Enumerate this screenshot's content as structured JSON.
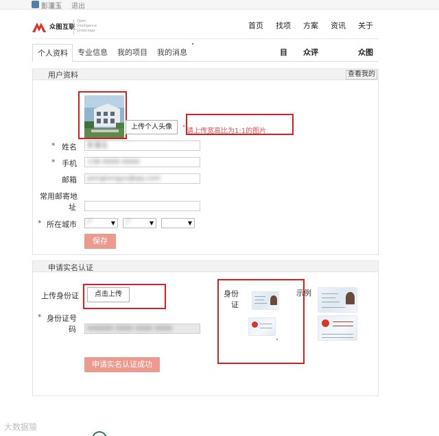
{
  "user_bar": {
    "username": "彭潼玉",
    "logout": "退出"
  },
  "header": {
    "logo_text": "众图互联",
    "logo_sub": "Open Intelligence Linkbridge",
    "nav": [
      "首页",
      "找项",
      "方案",
      "资讯",
      "关于"
    ]
  },
  "tabs": {
    "items": [
      "个人资料",
      "专业信息",
      "我的项目",
      "我的消息"
    ],
    "right": [
      "目",
      "众评",
      "众图"
    ]
  },
  "profile": {
    "section_title": "用户资料",
    "view_mine": "查看我的",
    "upload_avatar": "上传个人头像",
    "upload_hint": "请上传宽高比为1:1的图片",
    "required_mark": "*",
    "fields": {
      "name_label": "姓名",
      "name_value": "彭潼玉",
      "phone_label": "手机",
      "phone_value": "138 0000 0000",
      "email_label": "邮箱",
      "email_value": "pengtongyu@qq.com",
      "address_label_1": "常用邮寄地",
      "address_label_2": "址",
      "address_value": "",
      "city_label": "所在城市",
      "city_options": [
        "广",
        "广",
        ""
      ]
    },
    "save": "保存"
  },
  "verify": {
    "section_title": "申请实名认证",
    "id_upload_label": "上传身份证",
    "id_upload_button": "点击上传",
    "id_number_label_1": "身份证号",
    "id_number_label_2": "码",
    "id_number_value": "440000 0000 0000 0000",
    "id_card_label_1": "身份",
    "id_card_label_2": "证",
    "sample_label": "示例",
    "submit": "申请实名认证成功"
  },
  "watermark": "大数据猿"
}
